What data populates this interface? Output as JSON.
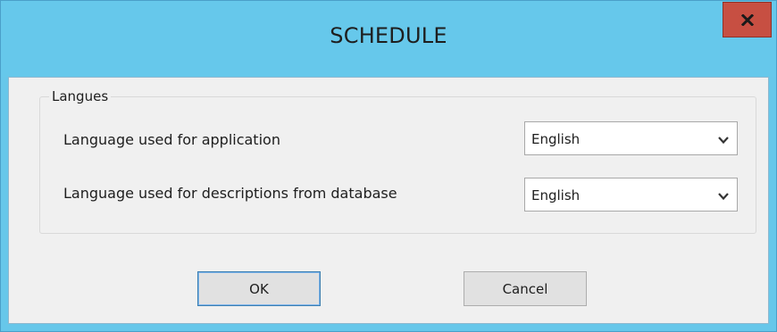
{
  "window": {
    "title": "SCHEDULE",
    "close_icon": "close-icon"
  },
  "group": {
    "legend": "Langues"
  },
  "rows": [
    {
      "label": "Language used for application",
      "value": "English"
    },
    {
      "label": "Language used for descriptions from database",
      "value": "English"
    }
  ],
  "buttons": {
    "ok": "OK",
    "cancel": "Cancel"
  },
  "colors": {
    "titlebar": "#66c8eb",
    "close_button": "#c74f42",
    "client_background": "#f0f0f0",
    "button_face": "#e1e1e1",
    "default_button_border": "#3c7fb1"
  }
}
